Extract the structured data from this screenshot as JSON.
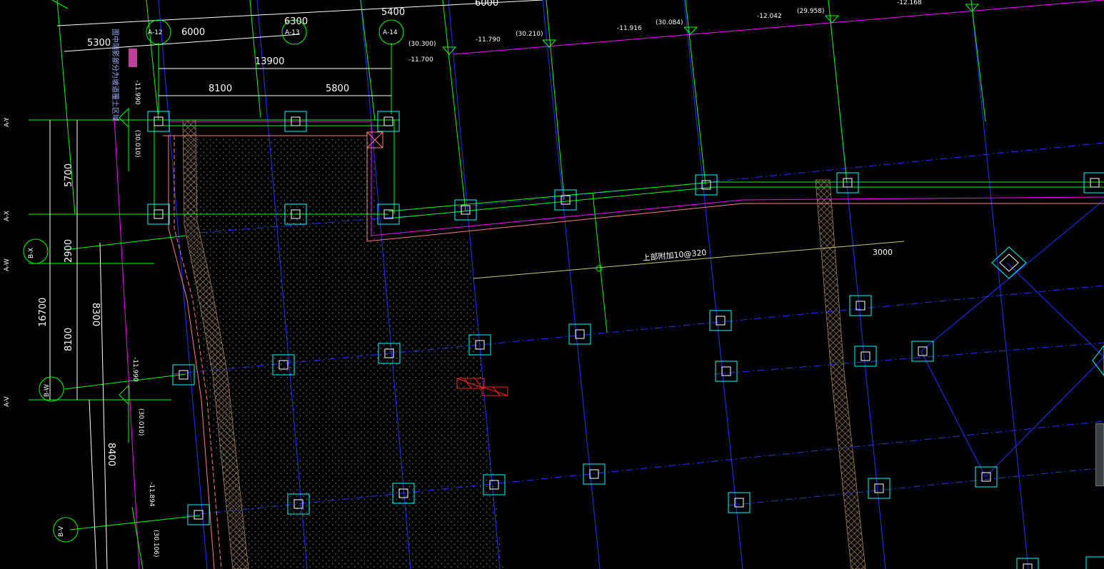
{
  "dimensions": {
    "top_6000": "6000",
    "top_5400": "5400",
    "top_6300": "6300",
    "row2_5300": "5300",
    "row2_6000": "6000",
    "dim_13900": "13900",
    "dim_8100": "8100",
    "dim_5800": "5800",
    "left_5700": "5700",
    "left_2900": "2900",
    "left_16700": "16700",
    "left_8300": "8300",
    "left_8100": "8100",
    "left_8400": "8400",
    "mid_3000": "3000"
  },
  "axes": {
    "a12": "A-12",
    "a13": "A-13",
    "a14": "A-14",
    "ay": "A-Y",
    "ax": "A-X",
    "aw": "A-W",
    "av": "A-V",
    "bx": "B-X",
    "bw": "B-W",
    "bv": "B-V"
  },
  "elevations": {
    "e1": "-11.990",
    "e2": "(30.010)",
    "e3": "-11.990",
    "e4": "(30.010)",
    "e5": "-11.894",
    "e6": "(30.106)",
    "e7": "(30.300)",
    "e8": "-11.700",
    "e9": "-11.790",
    "e10": "(30.210)",
    "e11": "-11.916",
    "e12": "(30.084)",
    "e13": "-12.042",
    "e14": "(29.958)",
    "e15": "-12.168"
  },
  "annotations": {
    "rebar": "上部附加10@320",
    "note_left": "图中阴影部分为坡道覆土区域"
  },
  "colors": {
    "background": "#000000",
    "grid_green": "#00ff00",
    "column_cyan": "#00ffff",
    "axis_blue": "#2233ff",
    "slope_magenta": "#ff00ff",
    "beam_pink": "#ff8080",
    "hatch_tan": "#a08060",
    "marker_red": "#ff2222",
    "note_yellow": "#ffff00"
  }
}
